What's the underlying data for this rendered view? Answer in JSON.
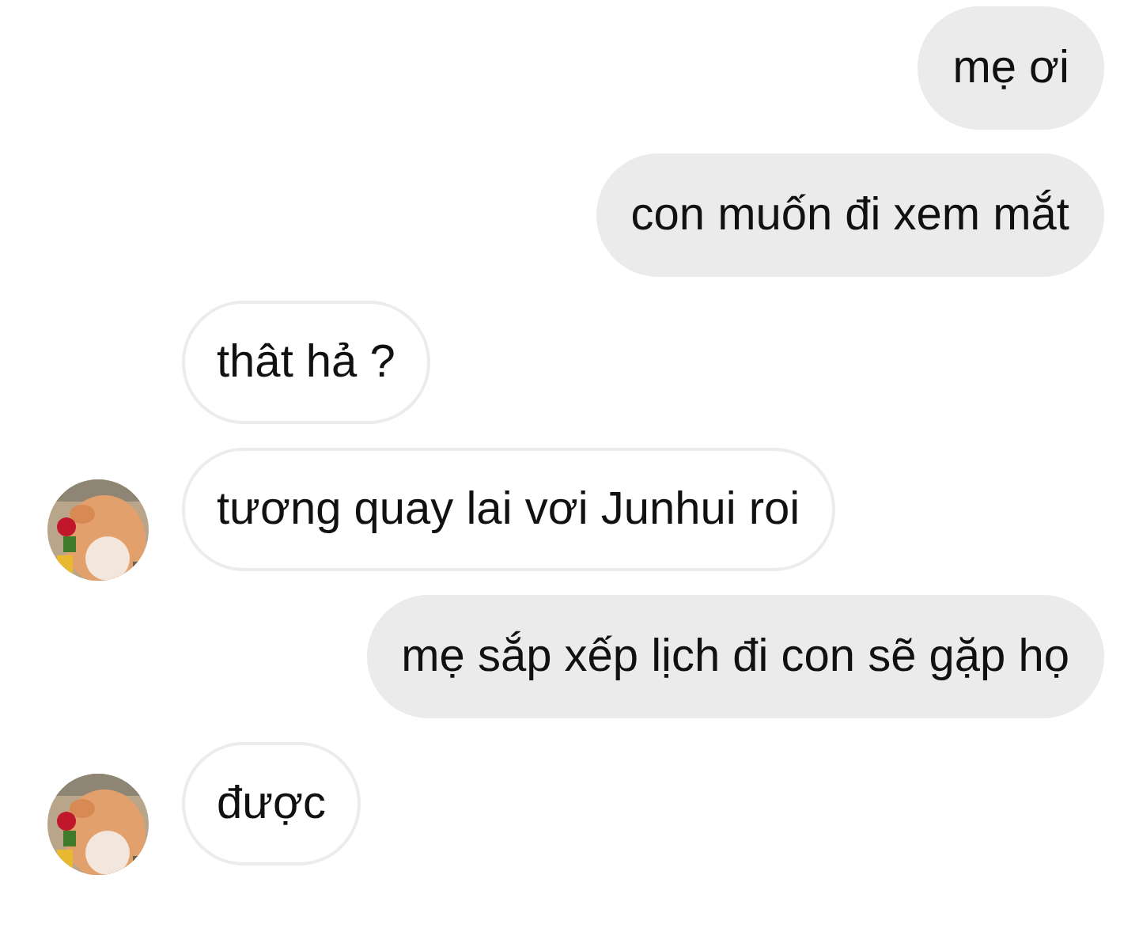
{
  "messages": [
    {
      "kind": "outgoing",
      "text": "mẹ ơi"
    },
    {
      "kind": "outgoing",
      "text": "con muốn đi xem mắt"
    },
    {
      "kind": "incoming",
      "text": "thât hả ?",
      "avatar": false
    },
    {
      "kind": "incoming",
      "text": "tương quay lai vơi Junhui roi",
      "avatar": true
    },
    {
      "kind": "outgoing",
      "text": "mẹ sắp xếp lịch đi con sẽ gặp họ"
    },
    {
      "kind": "incoming",
      "text": "được",
      "avatar": true
    }
  ]
}
